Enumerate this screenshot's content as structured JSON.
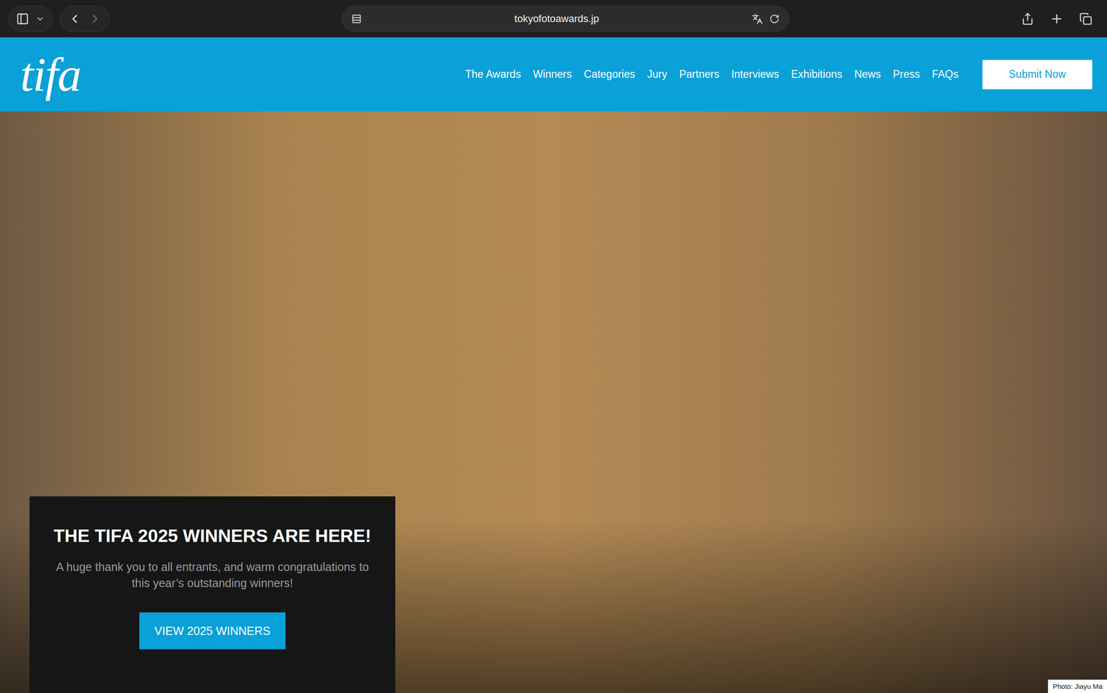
{
  "browser": {
    "url": "tokyofotoawards.jp",
    "back_disabled": false,
    "forward_disabled": true
  },
  "site": {
    "logo": "tifa",
    "nav": [
      "The Awards",
      "Winners",
      "Categories",
      "Jury",
      "Partners",
      "Interviews",
      "Exhibitions",
      "News",
      "Press",
      "FAQs"
    ],
    "cta": "Submit Now"
  },
  "hero": {
    "title": "THE TIFA 2025 WINNERS ARE HERE!",
    "text": "A huge thank you to all entrants, and warm congratulations to this year’s outstanding winners!",
    "button": "VIEW 2025 WINNERS",
    "credit": "Photo: Jiayu Ma"
  }
}
